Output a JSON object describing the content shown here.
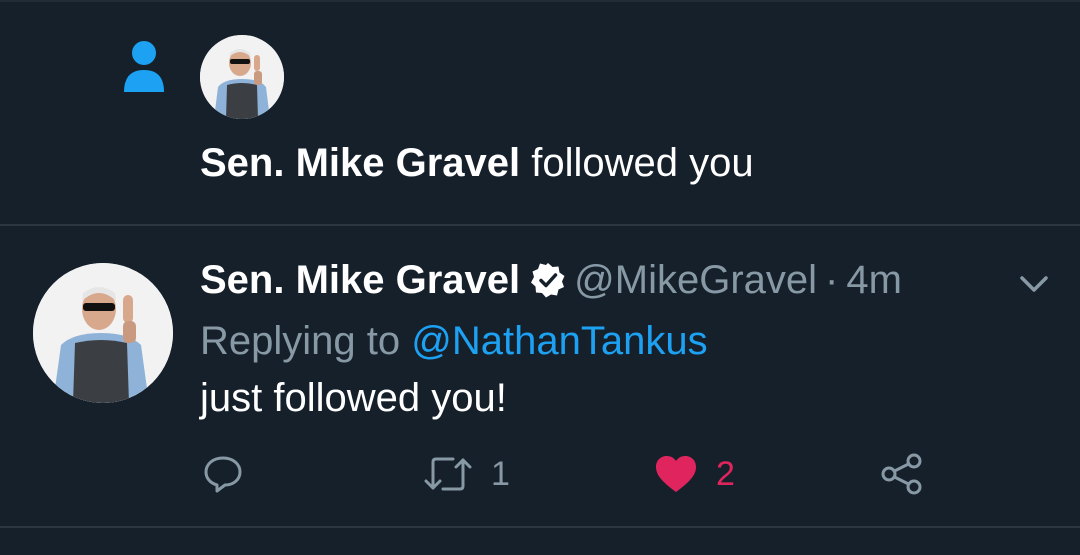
{
  "notification": {
    "user_name": "Sen. Mike Gravel",
    "action_text": " followed you",
    "icon": "person-icon"
  },
  "tweet": {
    "display_name": "Sen. Mike Gravel",
    "handle": "@MikeGravel",
    "separator": "·",
    "timestamp": "4m",
    "reply_prefix": "Replying to ",
    "reply_mention": "@NathanTankus",
    "text": "just followed you!",
    "actions": {
      "reply": {
        "icon": "reply-icon",
        "count": ""
      },
      "retweet": {
        "icon": "retweet-icon",
        "count": "1"
      },
      "like": {
        "icon": "heart-icon",
        "count": "2",
        "liked": true
      },
      "share": {
        "icon": "share-icon"
      }
    }
  },
  "colors": {
    "background": "#16202b",
    "accent": "#1da1f2",
    "like": "#e0245e",
    "muted": "#8899a6",
    "divider": "#2b3640"
  }
}
